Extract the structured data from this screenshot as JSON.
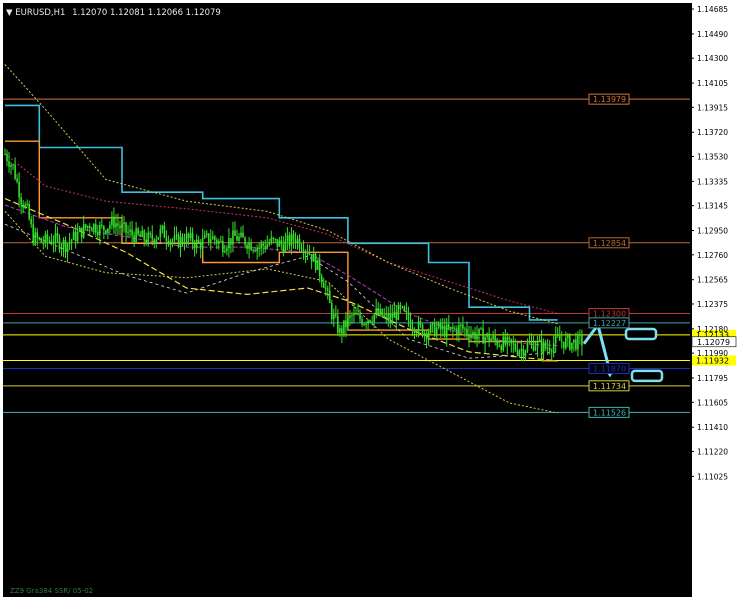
{
  "header": {
    "symbol_timeframe": "EURUSD,H1",
    "ohlc": "1.12070 1.12081 1.12066 1.12079"
  },
  "footer": {
    "label": "ZZ9 Gra384 SSR/ 05-02"
  },
  "colors": {
    "background": "#000000",
    "candles": "#35e02a",
    "axis_text": "#000000",
    "price_badge_yellow": "#ffff00",
    "arrow": "#7fdff0"
  },
  "chart_data": {
    "type": "candlestick",
    "title": "EURUSD,H1",
    "y_axis_ticks": [
      "1.14685",
      "1.14490",
      "1.14300",
      "1.14105",
      "1.13915",
      "1.13720",
      "1.13530",
      "1.13335",
      "1.13145",
      "1.12950",
      "1.12760",
      "1.12565",
      "1.12375",
      "1.12180",
      "1.11990",
      "1.11795",
      "1.11605",
      "1.11410",
      "1.11220",
      "1.11025"
    ],
    "ylim": [
      1.1097,
      1.1472
    ],
    "x_bars": 290,
    "current_price": 1.12079,
    "horizontal_levels": [
      {
        "price": 1.13979,
        "label": "1.13979",
        "color": "#d4733c"
      },
      {
        "price": 1.12854,
        "label": "1.12854",
        "color": "#b86a34"
      },
      {
        "price": 1.123,
        "label": "1.12300",
        "color": "#c03838"
      },
      {
        "price": 1.12227,
        "label": "1.12227",
        "color": "#3fa4a8"
      },
      {
        "price": 1.12133,
        "label": "1.12133",
        "color": "#ffff00"
      },
      {
        "price": 1.11932,
        "label": "1.11932",
        "color": "#ffff00"
      },
      {
        "price": 1.1187,
        "label": "1.11870",
        "color": "#1e2fc8"
      },
      {
        "price": 1.11734,
        "label": "1.11734",
        "color": "#d4cf3c"
      },
      {
        "price": 1.11526,
        "label": "1.11526",
        "color": "#3fb6b0"
      }
    ],
    "series": [
      {
        "kind": "price_close",
        "points": [
          [
            0,
            1.1355
          ],
          [
            4,
            1.1345
          ],
          [
            8,
            1.132
          ],
          [
            11,
            1.131
          ],
          [
            14,
            1.129
          ],
          [
            18,
            1.1286
          ],
          [
            24,
            1.1288
          ],
          [
            30,
            1.1284
          ],
          [
            36,
            1.1292
          ],
          [
            42,
            1.13
          ],
          [
            48,
            1.1296
          ],
          [
            54,
            1.1302
          ],
          [
            60,
            1.1294
          ],
          [
            66,
            1.129
          ],
          [
            72,
            1.1288
          ],
          [
            78,
            1.1294
          ],
          [
            84,
            1.1286
          ],
          [
            90,
            1.1289
          ],
          [
            96,
            1.1284
          ],
          [
            102,
            1.129
          ],
          [
            108,
            1.1284
          ],
          [
            114,
            1.129
          ],
          [
            120,
            1.1286
          ],
          [
            126,
            1.1282
          ],
          [
            132,
            1.1286
          ],
          [
            138,
            1.1284
          ],
          [
            144,
            1.1289
          ],
          [
            150,
            1.128
          ],
          [
            154,
            1.127
          ],
          [
            158,
            1.1255
          ],
          [
            162,
            1.123
          ],
          [
            166,
            1.1215
          ],
          [
            172,
            1.1228
          ],
          [
            178,
            1.1225
          ],
          [
            184,
            1.123
          ],
          [
            190,
            1.1226
          ],
          [
            196,
            1.1232
          ],
          [
            202,
            1.1222
          ],
          [
            208,
            1.1216
          ],
          [
            214,
            1.1218
          ],
          [
            220,
            1.1216
          ],
          [
            226,
            1.1219
          ],
          [
            232,
            1.1214
          ],
          [
            238,
            1.1212
          ],
          [
            244,
            1.1208
          ],
          [
            250,
            1.1205
          ],
          [
            256,
            1.1202
          ],
          [
            262,
            1.1207
          ],
          [
            268,
            1.1203
          ],
          [
            274,
            1.1209
          ],
          [
            280,
            1.1207
          ],
          [
            286,
            1.12079
          ]
        ]
      },
      {
        "kind": "cyan_step",
        "color": "#3cc2e0",
        "points": [
          [
            0,
            1.1393
          ],
          [
            17,
            1.1393
          ],
          [
            17,
            1.136
          ],
          [
            58,
            1.136
          ],
          [
            58,
            1.1325
          ],
          [
            98,
            1.1325
          ],
          [
            98,
            1.132
          ],
          [
            136,
            1.132
          ],
          [
            136,
            1.1305
          ],
          [
            170,
            1.1305
          ],
          [
            170,
            1.1285
          ],
          [
            210,
            1.1285
          ],
          [
            210,
            1.127
          ],
          [
            230,
            1.127
          ],
          [
            230,
            1.1235
          ],
          [
            260,
            1.1235
          ],
          [
            260,
            1.1225
          ],
          [
            274,
            1.1225
          ]
        ]
      },
      {
        "kind": "orange_step",
        "color": "#ff9a2e",
        "points": [
          [
            0,
            1.1365
          ],
          [
            17,
            1.1365
          ],
          [
            17,
            1.1305
          ],
          [
            58,
            1.1305
          ],
          [
            58,
            1.1285
          ],
          [
            98,
            1.1285
          ],
          [
            98,
            1.127
          ],
          [
            136,
            1.127
          ],
          [
            136,
            1.1278
          ],
          [
            170,
            1.1278
          ],
          [
            170,
            1.1217
          ],
          [
            210,
            1.1217
          ],
          [
            210,
            1.121
          ],
          [
            230,
            1.121
          ],
          [
            230,
            1.1208
          ],
          [
            266,
            1.1208
          ],
          [
            266,
            1.1193
          ],
          [
            274,
            1.1193
          ]
        ]
      },
      {
        "kind": "pink_dotted",
        "color": "#d2306a",
        "points": [
          [
            0,
            1.1355
          ],
          [
            20,
            1.133
          ],
          [
            50,
            1.1318
          ],
          [
            90,
            1.1312
          ],
          [
            130,
            1.1305
          ],
          [
            160,
            1.1292
          ],
          [
            190,
            1.127
          ],
          [
            220,
            1.1255
          ],
          [
            250,
            1.124
          ],
          [
            274,
            1.123
          ]
        ]
      },
      {
        "kind": "yellow_dotted_upper",
        "color": "#d9c84a",
        "points": [
          [
            0,
            1.1425
          ],
          [
            20,
            1.139
          ],
          [
            50,
            1.1335
          ],
          [
            90,
            1.1318
          ],
          [
            130,
            1.131
          ],
          [
            160,
            1.1295
          ],
          [
            190,
            1.127
          ],
          [
            220,
            1.125
          ],
          [
            250,
            1.1232
          ],
          [
            274,
            1.1222
          ]
        ]
      },
      {
        "kind": "yellow_dotted_lower",
        "color": "#d9c84a",
        "points": [
          [
            0,
            1.131
          ],
          [
            20,
            1.1275
          ],
          [
            50,
            1.1262
          ],
          [
            90,
            1.1258
          ],
          [
            130,
            1.1265
          ],
          [
            160,
            1.1255
          ],
          [
            190,
            1.121
          ],
          [
            220,
            1.1185
          ],
          [
            250,
            1.116
          ],
          [
            274,
            1.1152
          ]
        ]
      },
      {
        "kind": "yellow_dashed_ma",
        "color": "#f2e04a",
        "points": [
          [
            0,
            1.132
          ],
          [
            30,
            1.13
          ],
          [
            60,
            1.1278
          ],
          [
            90,
            1.125
          ],
          [
            120,
            1.1245
          ],
          [
            150,
            1.125
          ],
          [
            170,
            1.124
          ],
          [
            200,
            1.1218
          ],
          [
            230,
            1.12
          ],
          [
            260,
            1.1195
          ],
          [
            274,
            1.1193
          ]
        ]
      },
      {
        "kind": "white_dashed",
        "color": "#e0e0e0",
        "points": [
          [
            0,
            1.13
          ],
          [
            30,
            1.128
          ],
          [
            60,
            1.126
          ],
          [
            90,
            1.1246
          ],
          [
            120,
            1.1262
          ],
          [
            150,
            1.1275
          ],
          [
            170,
            1.1255
          ],
          [
            200,
            1.121
          ],
          [
            230,
            1.1195
          ],
          [
            260,
            1.1198
          ],
          [
            274,
            1.12
          ]
        ]
      },
      {
        "kind": "magenta_mid",
        "color": "#b03fb8",
        "points": [
          [
            0,
            1.1315
          ],
          [
            30,
            1.1298
          ],
          [
            60,
            1.129
          ],
          [
            90,
            1.1282
          ],
          [
            120,
            1.1282
          ],
          [
            150,
            1.1278
          ],
          [
            170,
            1.126
          ],
          [
            200,
            1.123
          ],
          [
            230,
            1.1212
          ],
          [
            260,
            1.1206
          ],
          [
            274,
            1.1205
          ]
        ]
      }
    ],
    "projection_arrow": {
      "from": 1.12079,
      "peak": 1.1221,
      "trough": 1.1189
    }
  }
}
